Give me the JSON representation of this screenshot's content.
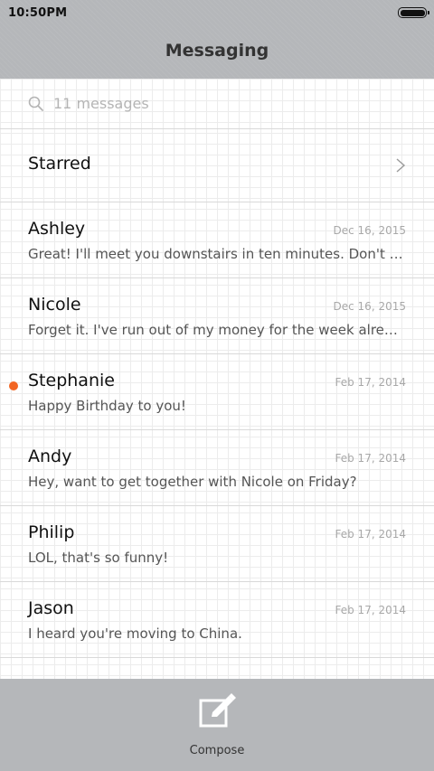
{
  "status_bar": {
    "time": "10:50PM"
  },
  "header": {
    "title": "Messaging"
  },
  "search": {
    "text": "11 messages",
    "icon": "search-icon"
  },
  "starred": {
    "label": "Starred",
    "icon": "chevron-right-icon"
  },
  "threads": [
    {
      "name": "Ashley",
      "date": "Dec 16, 2015",
      "preview": "Great! I'll meet you downstairs in ten minutes. Don't forge…",
      "unread": false
    },
    {
      "name": "Nicole",
      "date": "Dec 16, 2015",
      "preview": "Forget it. I've run out of my money for the week already.",
      "unread": false
    },
    {
      "name": "Stephanie",
      "date": "Feb 17, 2014",
      "preview": "Happy Birthday to you!",
      "unread": true
    },
    {
      "name": "Andy",
      "date": "Feb 17, 2014",
      "preview": "Hey, want to get together with Nicole on Friday?",
      "unread": false
    },
    {
      "name": "Philip",
      "date": "Feb 17, 2014",
      "preview": "LOL, that's so funny!",
      "unread": false
    },
    {
      "name": "Jason",
      "date": "Feb 17, 2014",
      "preview": "I heard you're moving to China.",
      "unread": false
    }
  ],
  "bottom_bar": {
    "compose_label": "Compose",
    "icon": "compose-icon"
  },
  "colors": {
    "unread_dot": "#f26522",
    "bars": "#b5b7ba"
  }
}
